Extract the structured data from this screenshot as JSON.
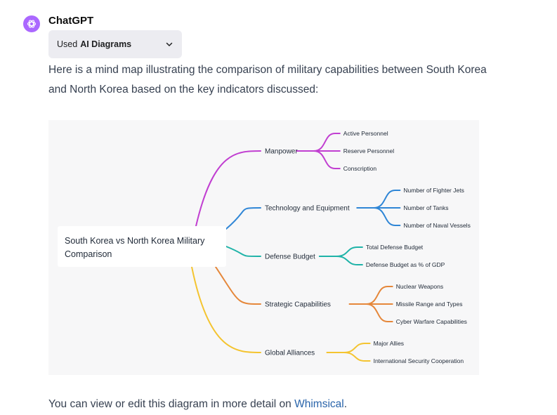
{
  "message": {
    "sender": "ChatGPT",
    "tool_used_prefix": "Used",
    "tool_name": "AI Diagrams",
    "intro_text": "Here is a mind map illustrating the comparison of military capabilities between South Korea and North Korea based on the key indicators discussed:",
    "footer_prefix": "You can view or edit this diagram in more detail on ",
    "footer_link": "Whimsical",
    "footer_suffix": "."
  },
  "icons": {
    "avatar": "openai-logo-icon",
    "tool_chevron": "chevron-down-icon"
  },
  "colors": {
    "avatar_bg": "#ab68ff",
    "link": "#2964aa",
    "branch_manpower": "#c13fd1",
    "branch_technology": "#2f86d6",
    "branch_budget": "#1fb3a8",
    "branch_strategic": "#e5873a",
    "branch_alliances": "#f4c430"
  },
  "mindmap": {
    "root": "South Korea vs North Korea Military Comparison",
    "branches": [
      {
        "label": "Manpower",
        "children": [
          "Active Personnel",
          "Reserve Personnel",
          "Conscription"
        ]
      },
      {
        "label": "Technology and Equipment",
        "children": [
          "Number of Fighter Jets",
          "Number of Tanks",
          "Number of Naval Vessels"
        ]
      },
      {
        "label": "Defense Budget",
        "children": [
          "Total Defense Budget",
          "Defense Budget as % of GDP"
        ]
      },
      {
        "label": "Strategic Capabilities",
        "children": [
          "Nuclear Weapons",
          "Missile Range and Types",
          "Cyber Warfare Capabilities"
        ]
      },
      {
        "label": "Global Alliances",
        "children": [
          "Major Allies",
          "International Security Cooperation"
        ]
      }
    ]
  }
}
